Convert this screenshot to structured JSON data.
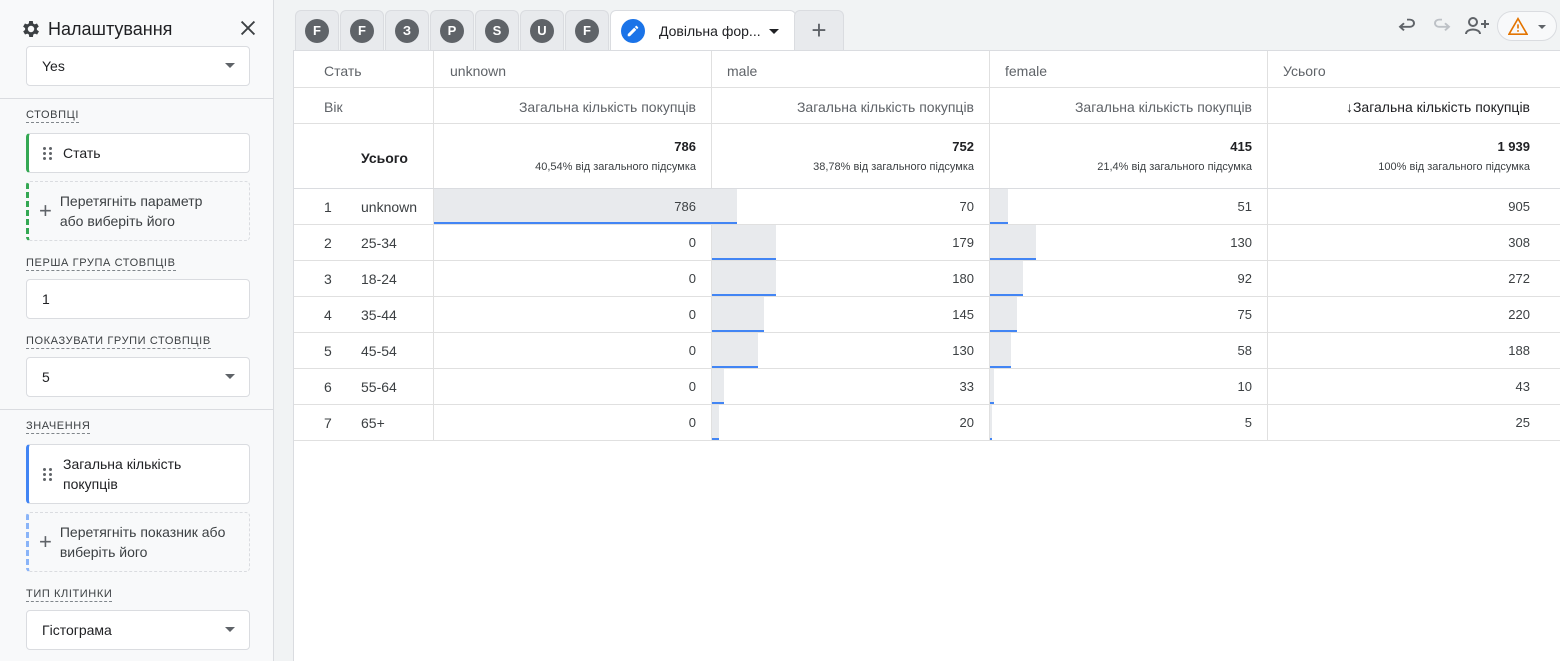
{
  "panel": {
    "title": "Налаштування",
    "top_select_value": "Yes",
    "columns_label": "СТОВПЦІ",
    "column_chip": "Стать",
    "drop_dimension_line1": "Перетягніть параметр",
    "drop_dimension_line2": "або виберіть його",
    "first_group_label": "ПЕРША ГРУПА СТОВПЦІВ",
    "first_group_value": "1",
    "show_groups_label": "ПОКАЗУВАТИ ГРУПИ СТОВПЦІВ",
    "show_groups_value": "5",
    "values_label": "ЗНАЧЕННЯ",
    "value_chip_line1": "Загальна кількість",
    "value_chip_line2": "покупців",
    "drop_metric_line1": "Перетягніть показник або",
    "drop_metric_line2": "виберіть його",
    "cell_type_label": "ТИП КЛІТИНКИ",
    "cell_type_value": "Гістограма"
  },
  "tabs": [
    {
      "letter": "F"
    },
    {
      "letter": "F"
    },
    {
      "letter": "З"
    },
    {
      "letter": "P"
    },
    {
      "letter": "S"
    },
    {
      "letter": "U"
    },
    {
      "letter": "F"
    }
  ],
  "active_tab": {
    "label": "Довільна фор..."
  },
  "add_tab": "+",
  "table": {
    "row_dim_header": "Стать",
    "age_header": "Вік",
    "columns": [
      {
        "name": "unknown",
        "metric": "Загальна кількість покупців",
        "total": "786",
        "share": "40,54% від загального підсумка"
      },
      {
        "name": "male",
        "metric": "Загальна кількість покупців",
        "total": "752",
        "share": "38,78% від загального підсумка"
      },
      {
        "name": "female",
        "metric": "Загальна кількість покупців",
        "total": "415",
        "share": "21,4% від загального підсумка"
      },
      {
        "name": "Усього",
        "metric": "Загальна кількість покупців",
        "total": "1 939",
        "share": "100% від загального підсумка"
      }
    ],
    "sort_arrow": "↓",
    "totals_label": "Усього",
    "rows": [
      {
        "idx": "1",
        "age": "unknown",
        "values": [
          "786",
          "70",
          "51",
          "905"
        ],
        "fill": [
          1.0,
          0.391,
          0.392
        ]
      },
      {
        "idx": "2",
        "age": "25-34",
        "values": [
          "0",
          "179",
          "130",
          "308"
        ],
        "fill": [
          0,
          1.0,
          1.0
        ]
      },
      {
        "idx": "3",
        "age": "18-24",
        "values": [
          "0",
          "180",
          "92",
          "272"
        ],
        "fill": [
          0,
          1.0,
          0.708
        ]
      },
      {
        "idx": "4",
        "age": "35-44",
        "values": [
          "0",
          "145",
          "75",
          "220"
        ],
        "fill": [
          0,
          0.806,
          0.577
        ]
      },
      {
        "idx": "5",
        "age": "45-54",
        "values": [
          "0",
          "130",
          "58",
          "188"
        ],
        "fill": [
          0,
          0.722,
          0.446
        ]
      },
      {
        "idx": "6",
        "age": "55-64",
        "values": [
          "0",
          "33",
          "10",
          "43"
        ],
        "fill": [
          0,
          0.183,
          0.077
        ]
      },
      {
        "idx": "7",
        "age": "65+",
        "values": [
          "0",
          "20",
          "5",
          "25"
        ],
        "fill": [
          0,
          0.111,
          0.038
        ]
      }
    ]
  },
  "colors": {
    "accent": "#1a73e8",
    "bar_line": "#4285f4",
    "bar_fill": "#e8eaed",
    "warning": "#e37400"
  }
}
